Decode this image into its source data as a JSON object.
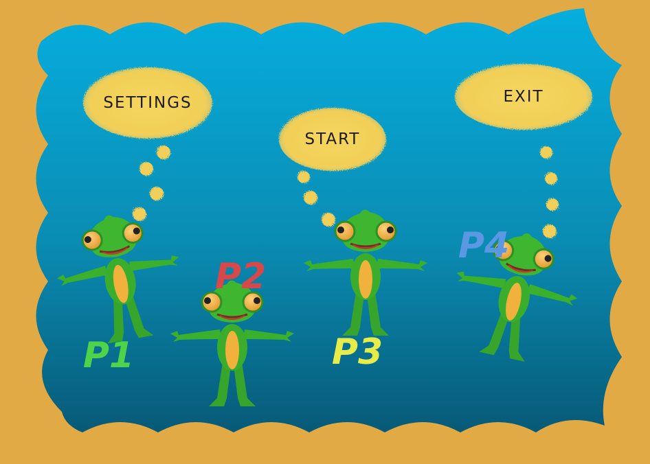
{
  "menu": {
    "settings_label": "SETTINGS",
    "start_label": "START",
    "exit_label": "EXIT"
  },
  "players": [
    {
      "tag": "P1",
      "color": "#4fd34a"
    },
    {
      "tag": "P2",
      "color": "#d8474a"
    },
    {
      "tag": "P3",
      "color": "#e6ec4a"
    },
    {
      "tag": "P4",
      "color": "#5a98e3"
    }
  ],
  "colors": {
    "frame": "#e2aa45",
    "sky_top": "#06a9d8",
    "sky_bottom": "#07607e",
    "cloud": "#f3d25a",
    "frog_green": "#3aae2c",
    "frog_belly": "#f0b23d"
  }
}
